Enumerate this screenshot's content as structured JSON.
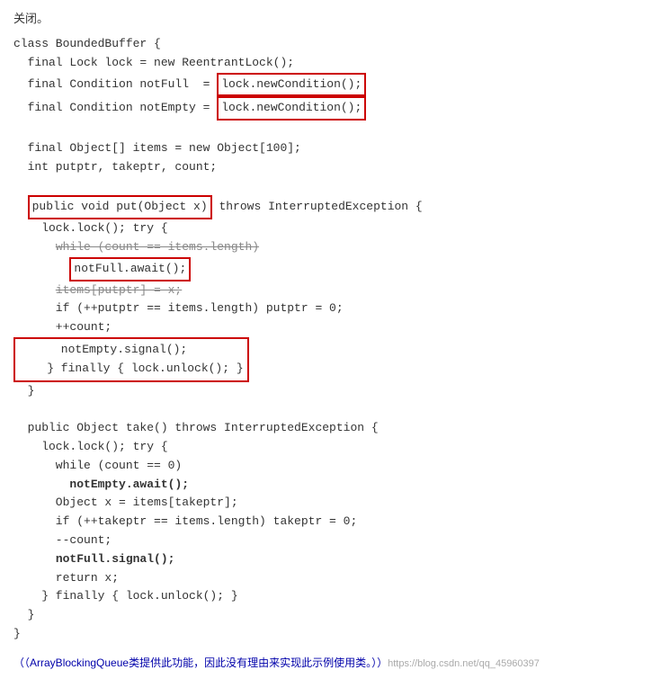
{
  "intro": "关闭。",
  "code": {
    "class_start": "class BoundedBuffer {",
    "line_lock": "  final Lock lock = new ReentrantLock();",
    "line_notFull": "  final Condition notFull  = lock.newCondition();",
    "line_notEmpty": "  final Condition notEmpty = lock.newCondition();",
    "line_blank1": "",
    "line_items": "  final Object[] items = new Object[100];",
    "line_ptrs": "  int putptr, takeptr, count;",
    "line_blank2": "",
    "line_put_sig": "  public void put(Object x) throws InterruptedException {",
    "line_lock_try": "    lock.lock(); try {",
    "line_while_put": "      while (count == items.length)",
    "line_notFull_await": "        notFull.await();",
    "line_items_put": "      items[putptr] = x;",
    "line_if_put": "      if (++putptr == items.length) putptr = 0;",
    "line_count_inc": "      ++count;",
    "line_notEmpty_signal": "      notEmpty.signal();",
    "line_finally_put": "    } finally { lock.unlock(); }",
    "line_put_end": "  }",
    "line_blank3": "",
    "line_take_sig": "  public Object take() throws InterruptedException {",
    "line_lock_try2": "    lock.lock(); try {",
    "line_while_take": "      while (count == 0)",
    "line_notEmpty_await": "        notEmpty.await();",
    "line_obj_x": "      Object x = items[takeptr];",
    "line_if_take": "      if (++takeptr == items.length) takeptr = 0;",
    "line_count_dec": "      --count;",
    "line_notFull_signal": "      notFull.signal();",
    "line_return_x": "      return x;",
    "line_finally_take": "    } finally { lock.unlock(); }",
    "line_take_end": "  }",
    "class_end": "}",
    "footer": "（ArrayBlockingQueue类提供此功能，因此没有理由来实现此示例使用类。）",
    "watermark": "https://blog.csdn.net/qq_45960397"
  }
}
